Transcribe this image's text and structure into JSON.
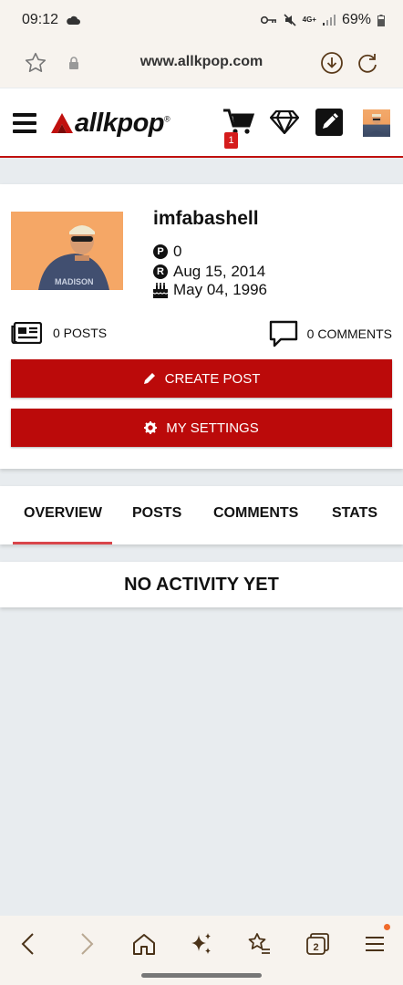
{
  "status_bar": {
    "time": "09:12",
    "network": "4G+",
    "battery": "69%",
    "icons": [
      "cloud-icon",
      "key-icon",
      "mute-icon",
      "signal-icon",
      "battery-icon"
    ]
  },
  "browser": {
    "url": "www.allkpop.com",
    "icons": [
      "star-icon",
      "lock-icon",
      "download-icon",
      "reload-icon"
    ]
  },
  "header": {
    "logo_text": "allkpop",
    "logo_reg": "®",
    "cart_count": "1",
    "brand_color": "#c0100e",
    "icons": [
      "menu-icon",
      "cart-icon",
      "diamond-icon",
      "edit-icon",
      "avatar"
    ]
  },
  "profile": {
    "username": "imfabashell",
    "points": "0",
    "registered": "Aug 15, 2014",
    "birthday": "May 04, 1996",
    "points_badge": "P",
    "registered_badge": "R",
    "posts_label": "0 POSTS",
    "comments_label": "0 COMMENTS",
    "create_post_label": "CREATE POST",
    "settings_label": "MY SETTINGS",
    "button_color": "#bb0a0a"
  },
  "tabs": [
    {
      "label": "OVERVIEW",
      "active": true
    },
    {
      "label": "POSTS",
      "active": false
    },
    {
      "label": "COMMENTS",
      "active": false
    },
    {
      "label": "STATS",
      "active": false
    }
  ],
  "activity": {
    "message": "NO ACTIVITY YET"
  },
  "bottom_nav": {
    "tab_count": "2",
    "icons": [
      "back-icon",
      "forward-icon",
      "home-icon",
      "sparkle-icon",
      "bookmarks-icon",
      "tabs-icon",
      "menu-icon"
    ]
  }
}
